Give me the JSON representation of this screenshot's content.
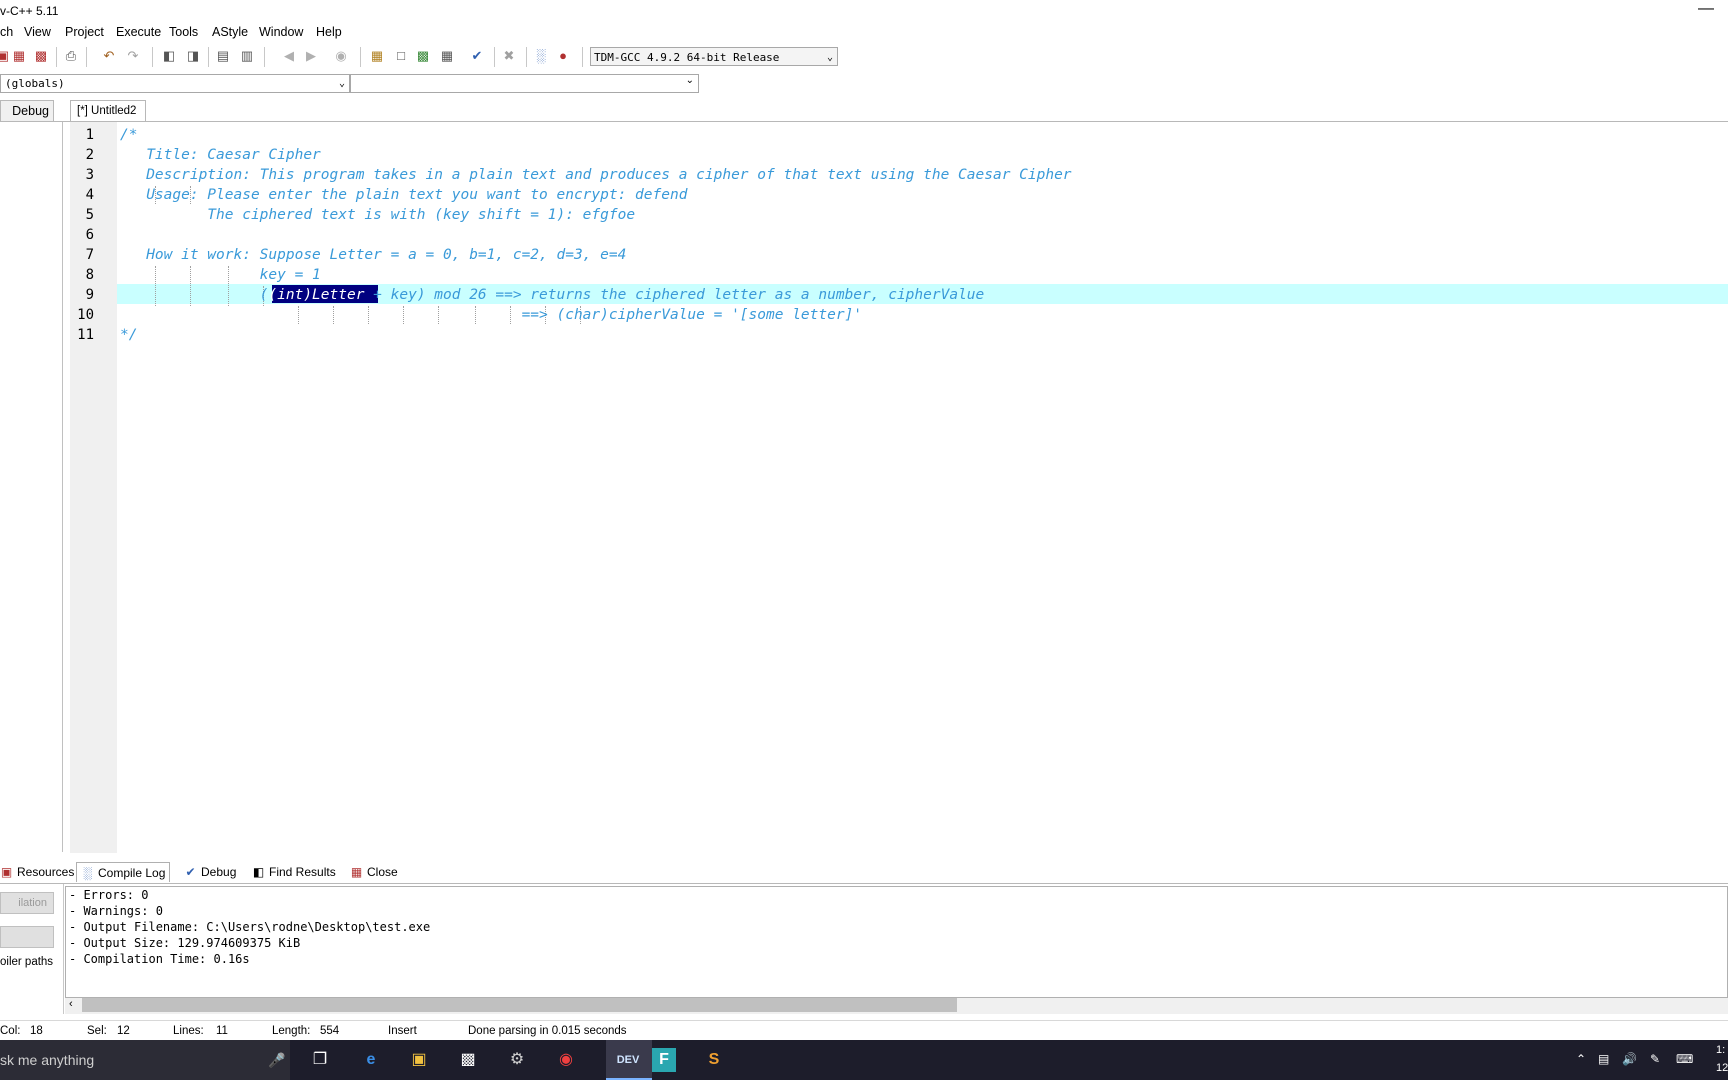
{
  "window": {
    "title": "v-C++ 5.11"
  },
  "menu": [
    "ch",
    "View",
    "Project",
    "Execute",
    "Tools",
    "AStyle",
    "Window",
    "Help"
  ],
  "toolbar": {
    "compiler": "TDM-GCC 4.9.2 64-bit Release"
  },
  "scope": {
    "value": "(globals)",
    "member_value": ""
  },
  "tabs": {
    "left_tab": "Debug",
    "editor_tab": "[*] Untitled2"
  },
  "editor": {
    "line_numbers": [
      "1",
      "2",
      "3",
      "4",
      "5",
      "6",
      "7",
      "8",
      "9",
      "10",
      "11"
    ],
    "lines": [
      "/*",
      "   Title: Caesar Cipher",
      "   Description: This program takes in a plain text and produces a cipher of that text using the Caesar Cipher",
      "   Usage: Please enter the plain text you want to encrypt: defend",
      "          The ciphered text is with (key shift = 1): efgfoe",
      "",
      "   How it work: Suppose Letter = a = 0, b=1, c=2, d=3, e=4",
      "                key = 1",
      "",
      "                                              ==> (char)cipherValue = '[some letter]'",
      "*/"
    ],
    "line9": {
      "before": "                (",
      "selected": "(int)Letter ",
      "after": "+ key) mod 26 ==> returns the ciphered letter as a number, cipherValue"
    }
  },
  "bottom_tabs": {
    "resources": "Resources",
    "compile_log": "Compile Log",
    "debug": "Debug",
    "find_results": "Find Results",
    "close": "Close"
  },
  "left_panel": {
    "btn1": "ilation",
    "btn2": "",
    "label": "oiler paths"
  },
  "compile_log": [
    "- Errors: 0",
    "- Warnings: 0",
    "- Output Filename: C:\\Users\\rodne\\Desktop\\test.exe",
    "- Output Size: 129.974609375 KiB",
    "- Compilation Time: 0.16s"
  ],
  "status": {
    "col_label": "Col:",
    "col": "18",
    "sel_label": "Sel:",
    "sel": "12",
    "lines_label": "Lines:",
    "lines": "11",
    "length_label": "Length:",
    "length": "554",
    "mode": "Insert",
    "message": "Done parsing in 0.015 seconds"
  },
  "taskbar": {
    "search": "sk me anything",
    "clock": "1:",
    "date": "12/"
  }
}
